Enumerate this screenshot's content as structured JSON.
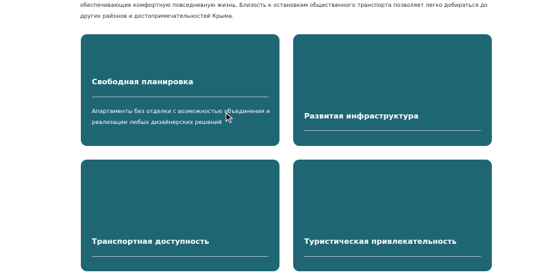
{
  "intro": {
    "line1": "обеспечивающие комфортную повседневную жизнь. Близость к остановкам общественного транспорта позволяет легко добираться до",
    "line2": "других районов и достопримечательностей Крыма."
  },
  "cards": [
    {
      "title": "Свободная планировка",
      "description": "Апартаменты без отделки с возможностью объединения и реализации любых дизайнерских решений"
    },
    {
      "title": "Развитая инфраструктура",
      "description": ""
    },
    {
      "title": "Транспортная доступность",
      "description": ""
    },
    {
      "title": "Туристическая привлекательность",
      "description": ""
    }
  ],
  "colors": {
    "card_background": "#1f6675",
    "text_primary": "#2b2b2b"
  },
  "icons": {
    "cursor": "mouse-pointer-icon"
  }
}
